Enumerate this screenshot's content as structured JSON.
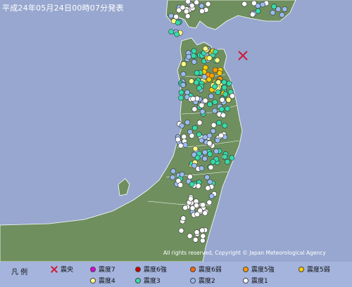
{
  "header": {
    "text": "平成24年05月24日00時07分発表"
  },
  "copyright": "All rights reserved, Copyright © Japan Meteorological Agency",
  "legend": {
    "title": "凡 例",
    "epicenter": "震央",
    "items": [
      {
        "label": "震度7",
        "color": "#e000e0"
      },
      {
        "label": "震度6強",
        "color": "#cc0000"
      },
      {
        "label": "震度6弱",
        "color": "#ff6600"
      },
      {
        "label": "震度5強",
        "color": "#ff9900"
      },
      {
        "label": "震度5弱",
        "color": "#ffcc00"
      },
      {
        "label": "震度4",
        "color": "#ffff88"
      },
      {
        "label": "震度3",
        "color": "#33ddaa"
      },
      {
        "label": "震度2",
        "color": "#99bbee"
      },
      {
        "label": "震度1",
        "color": "#ffffff"
      }
    ]
  },
  "colors": {
    "sea": "#97a7cf",
    "land": "#6f8f5f",
    "epicenter": "#d11b3a"
  }
}
